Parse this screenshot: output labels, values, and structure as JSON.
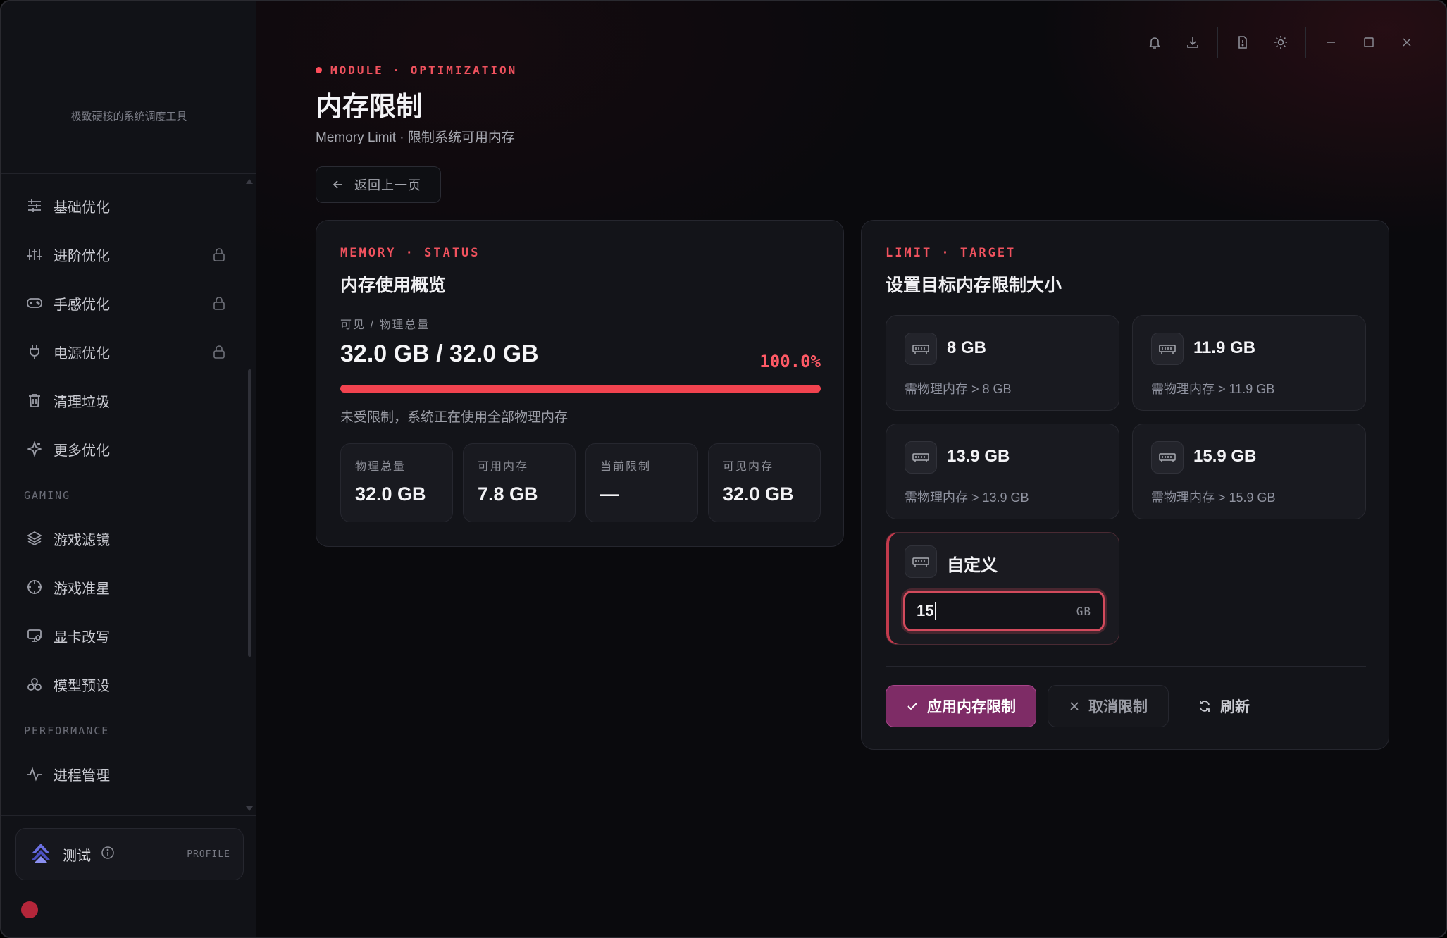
{
  "app": {
    "tagline": "极致硬核的系统调度工具"
  },
  "sidebar": {
    "items": [
      {
        "label": "基础优化",
        "icon": "sliders-icon",
        "locked": false
      },
      {
        "label": "进阶优化",
        "icon": "equalizer-icon",
        "locked": true
      },
      {
        "label": "手感优化",
        "icon": "gamepad-icon",
        "locked": true
      },
      {
        "label": "电源优化",
        "icon": "plug-icon",
        "locked": true
      },
      {
        "label": "清理垃圾",
        "icon": "trash-icon",
        "locked": false
      },
      {
        "label": "更多优化",
        "icon": "sparkle-icon",
        "locked": false
      }
    ],
    "gaming_label": "GAMING",
    "gaming_items": [
      {
        "label": "游戏滤镜",
        "icon": "layers-icon"
      },
      {
        "label": "游戏准星",
        "icon": "crosshair-icon"
      },
      {
        "label": "显卡改写",
        "icon": "monitor-icon"
      },
      {
        "label": "模型预设",
        "icon": "cubes-icon"
      }
    ],
    "performance_label": "PERFORMANCE",
    "performance_items": [
      {
        "label": "进程管理",
        "icon": "activity-icon"
      }
    ],
    "profile": {
      "name": "测试",
      "tag": "PROFILE"
    }
  },
  "header": {
    "eyebrow": "MODULE · OPTIMIZATION",
    "title": "内存限制",
    "subtitle": "Memory Limit · 限制系统可用内存",
    "back_label": "返回上一页"
  },
  "status_card": {
    "eyebrow": "MEMORY · STATUS",
    "title": "内存使用概览",
    "visible_label": "可见 / 物理总量",
    "visible_value": "32.0 GB / 32.0 GB",
    "percent_text": "100.0%",
    "percent": 100.0,
    "note": "未受限制，系统正在使用全部物理内存",
    "stats": [
      {
        "label": "物理总量",
        "value": "32.0 GB"
      },
      {
        "label": "可用内存",
        "value": "7.8 GB"
      },
      {
        "label": "当前限制",
        "value": "—"
      },
      {
        "label": "可见内存",
        "value": "32.0 GB"
      }
    ]
  },
  "target_card": {
    "eyebrow": "LIMIT · TARGET",
    "title": "设置目标内存限制大小",
    "options": [
      {
        "size": "8 GB",
        "requirement": "需物理内存 > 8 GB"
      },
      {
        "size": "11.9 GB",
        "requirement": "需物理内存 > 11.9 GB"
      },
      {
        "size": "13.9 GB",
        "requirement": "需物理内存 > 13.9 GB"
      },
      {
        "size": "15.9 GB",
        "requirement": "需物理内存 > 15.9 GB"
      }
    ],
    "custom": {
      "label": "自定义",
      "value": "15",
      "unit": "GB"
    },
    "actions": {
      "apply": "应用内存限制",
      "cancel": "取消限制",
      "refresh": "刷新"
    }
  },
  "colors": {
    "accent": "#f0525e",
    "apply": "#7e2c66",
    "bar": "#f2434f"
  }
}
